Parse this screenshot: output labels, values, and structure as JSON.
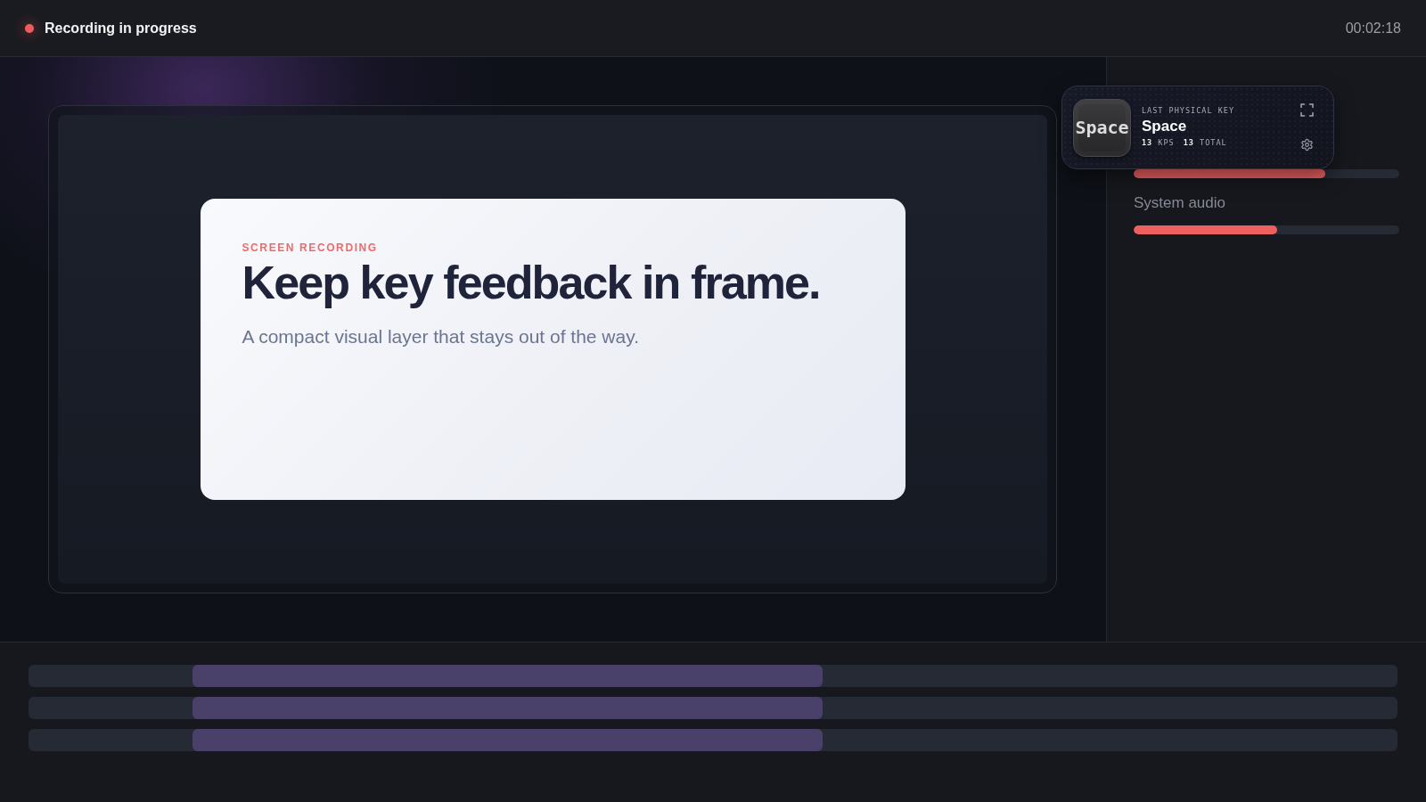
{
  "status_bar": {
    "live": true,
    "label": "Recording in progress",
    "timer": "00:02:18"
  },
  "preview": {
    "eyebrow": "SCREEN RECORDING",
    "headline": "Keep key feedback in frame.",
    "subtitle": "A compact visual layer that stays out of the way."
  },
  "key_overlay": {
    "caption": "LAST PHYSICAL KEY",
    "keycap": "Space",
    "key_name": "Space",
    "stats": [
      "**13** KPS",
      "**13** TOTAL"
    ]
  },
  "meters": [
    {
      "level": 0.72
    },
    {
      "label": "System audio",
      "level": 0.54
    }
  ],
  "timeline": {
    "tracks": [
      {
        "kind": "clip"
      },
      {
        "kind": "clip"
      },
      {
        "kind": "clip"
      }
    ]
  }
}
